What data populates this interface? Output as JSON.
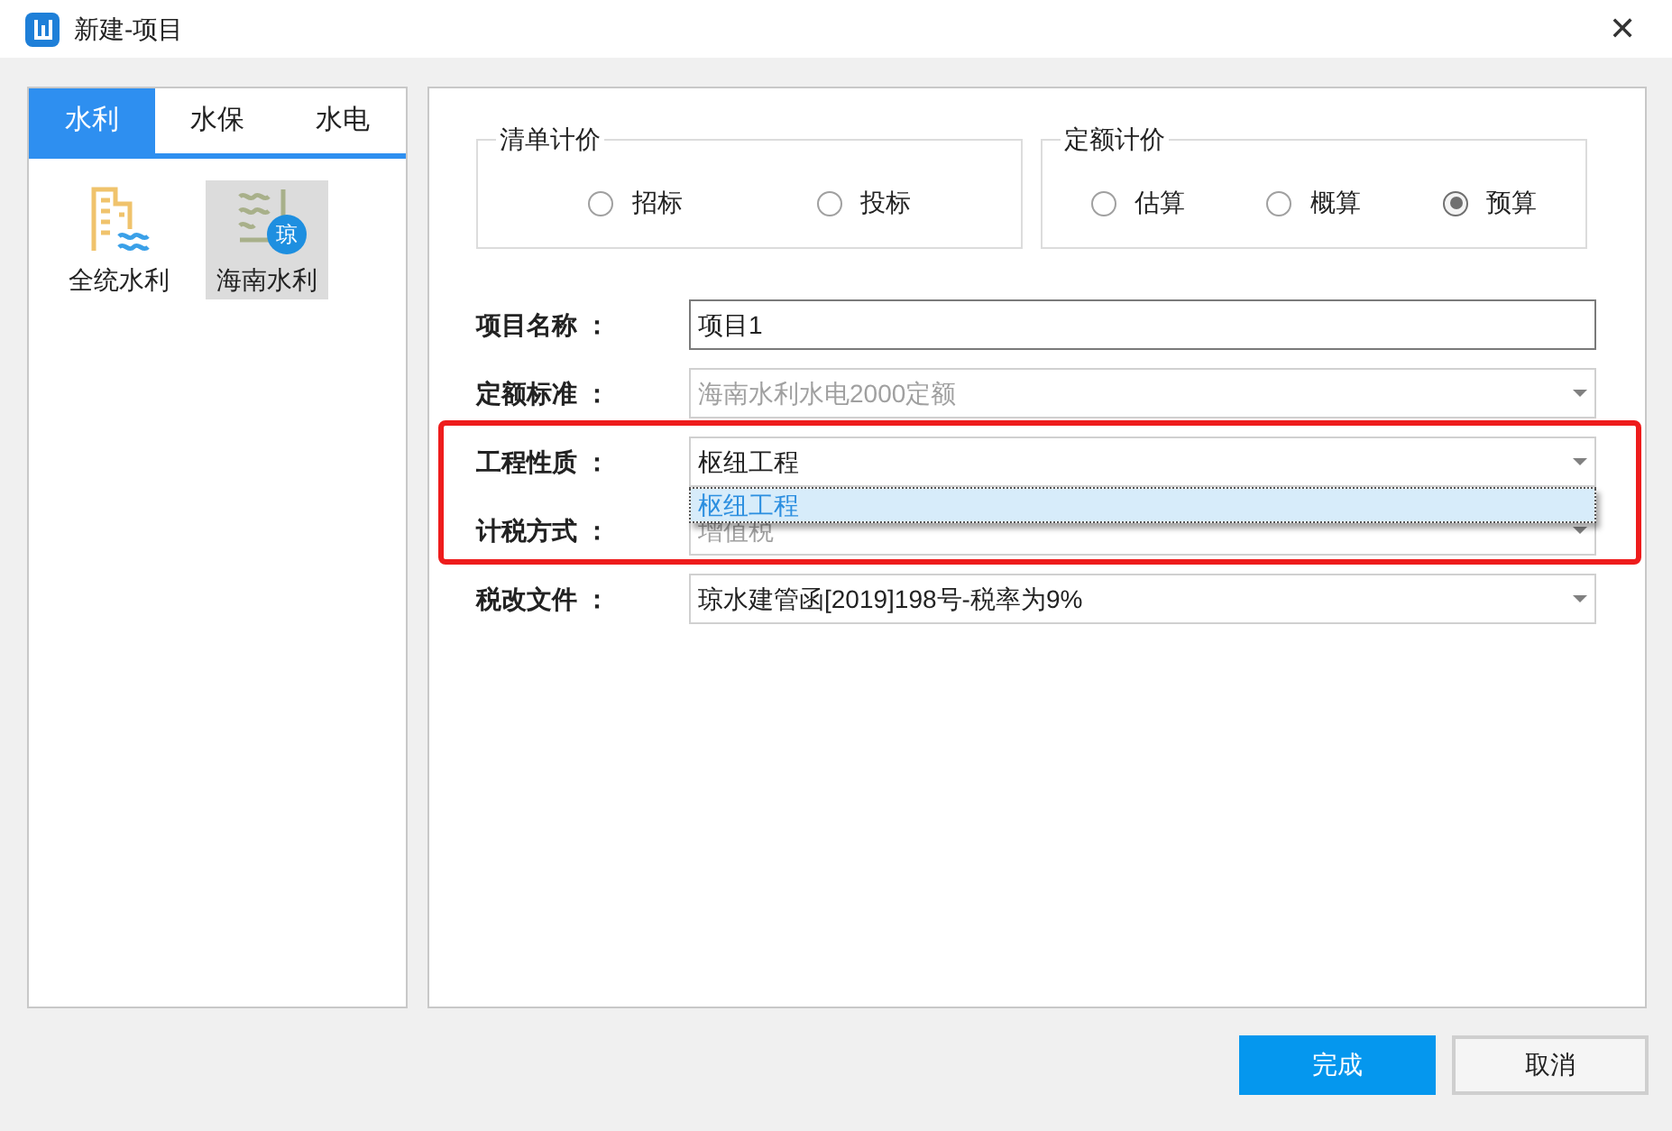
{
  "window": {
    "title": "新建-项目",
    "close": "✕"
  },
  "tabs": [
    {
      "label": "水利",
      "selected": true
    },
    {
      "label": "水保",
      "selected": false
    },
    {
      "label": "水电",
      "selected": false
    }
  ],
  "templates": [
    {
      "label": "全统水利",
      "selected": false,
      "kind": "building"
    },
    {
      "label": "海南水利",
      "selected": true,
      "kind": "dam",
      "badge": "琼"
    }
  ],
  "pricing_groups": [
    {
      "title": "清单计价",
      "options": [
        {
          "label": "招标",
          "selected": false
        },
        {
          "label": "投标",
          "selected": false
        }
      ]
    },
    {
      "title": "定额计价",
      "options": [
        {
          "label": "估算",
          "selected": false
        },
        {
          "label": "概算",
          "selected": false
        },
        {
          "label": "预算",
          "selected": true
        }
      ]
    }
  ],
  "fields": [
    {
      "label": "项目名称 ：",
      "value": "项目1",
      "kind": "text",
      "disabled": false
    },
    {
      "label": "定额标准 ：",
      "value": "海南水利水电2000定额",
      "kind": "select",
      "disabled": true
    },
    {
      "label": "工程性质 ：",
      "value": "枢纽工程",
      "kind": "select",
      "disabled": false,
      "dropdown": [
        "枢纽工程"
      ]
    },
    {
      "label": "计税方式 ：",
      "value": "增值税",
      "kind": "select",
      "disabled": true
    },
    {
      "label": "税改文件 ：",
      "value": "琼水建管函[2019]198号-税率为9%",
      "kind": "select",
      "disabled": false
    }
  ],
  "buttons": [
    {
      "label": "完成",
      "kind": "primary"
    },
    {
      "label": "取消",
      "kind": "default"
    }
  ]
}
